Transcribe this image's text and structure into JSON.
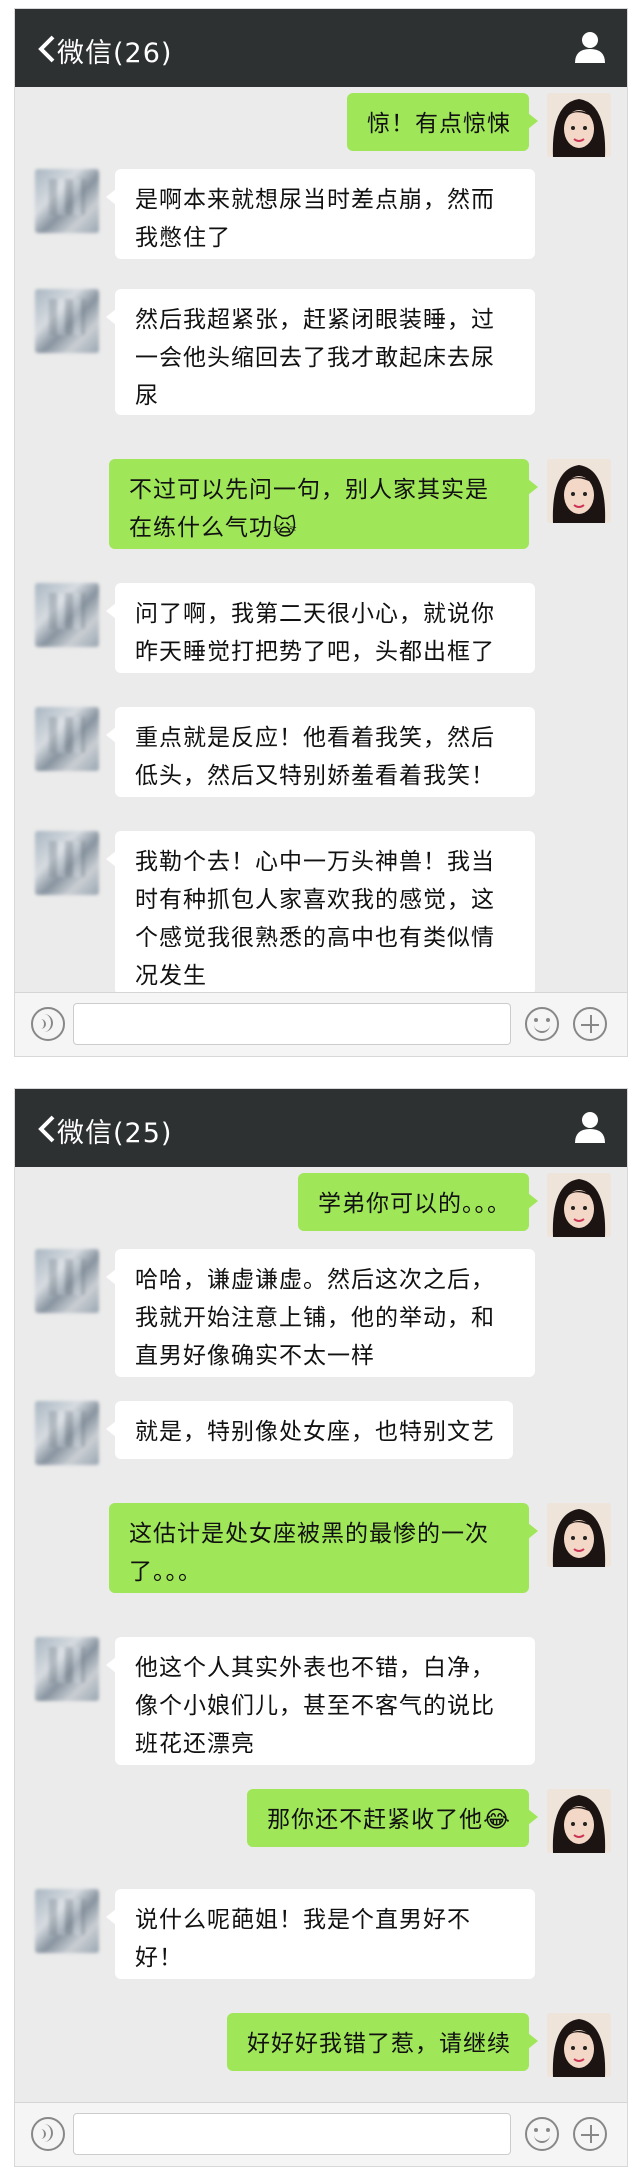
{
  "screens": [
    {
      "title": "微信(26)",
      "messages": [
        {
          "side": "right",
          "text": "惊！有点惊悚"
        },
        {
          "side": "left",
          "text": "是啊本来就想尿当时差点崩，然而我憋住了"
        },
        {
          "side": "left",
          "text": "然后我超紧张，赶紧闭眼装睡，过一会他头缩回去了我才敢起床去尿尿"
        },
        {
          "side": "right",
          "text": "不过可以先问一句，别人家其实是在练什么气功🙀"
        },
        {
          "side": "left",
          "text": "问了啊，我第二天很小心，就说你昨天睡觉打把势了吧，头都出框了"
        },
        {
          "side": "left",
          "text": "重点就是反应！他看着我笑，然后低头，然后又特别娇羞看着我笑！"
        },
        {
          "side": "left",
          "text": "我勒个去！心中一万头神兽！我当时有种抓包人家喜欢我的感觉，这个感觉我很熟悉的高中也有类似情况发生"
        }
      ],
      "watermark": "…"
    },
    {
      "title": "微信(25)",
      "messages": [
        {
          "side": "right",
          "text": "学弟你可以的。。。"
        },
        {
          "side": "left",
          "text": "哈哈，谦虚谦虚。然后这次之后，我就开始注意上铺，他的举动，和直男好像确实不太一样"
        },
        {
          "side": "left",
          "text": "就是，特别像处女座，也特别文艺"
        },
        {
          "side": "right",
          "text": "这估计是处女座被黑的最惨的一次了。。。"
        },
        {
          "side": "left",
          "text": "他这个人其实外表也不错，白净，像个小娘们儿，甚至不客气的说比班花还漂亮"
        },
        {
          "side": "right",
          "text": "那你还不赶紧收了他😂"
        },
        {
          "side": "left",
          "text": "说什么呢葩姐！我是个直男好不好！"
        },
        {
          "side": "right",
          "text": "好好好我错了惹，请继续"
        }
      ],
      "watermark": "…"
    }
  ],
  "icons": {
    "back": "chevron-left-icon",
    "user": "user-icon",
    "voice": "voice-icon",
    "emoji": "emoji-icon",
    "plus": "plus-icon"
  },
  "colors": {
    "titlebar": "#2e3132",
    "chat_bg": "#ebebeb",
    "bubble_right": "#9fe658",
    "bubble_left": "#ffffff"
  }
}
